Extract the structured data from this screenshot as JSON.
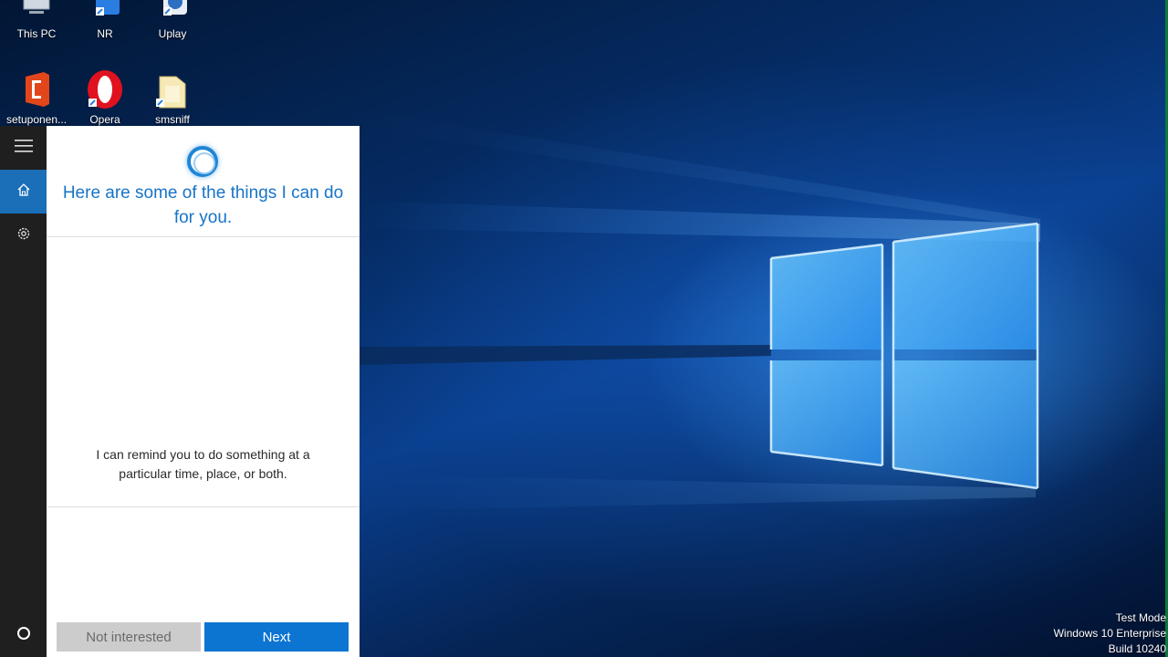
{
  "desktop": {
    "icons": [
      {
        "label": "This PC",
        "icon": "computer-icon"
      },
      {
        "label": "NR",
        "icon": "nr-app-icon"
      },
      {
        "label": "Uplay",
        "icon": "uplay-icon"
      },
      {
        "label": "setuponen...",
        "icon": "office-setup-icon"
      },
      {
        "label": "Opera",
        "icon": "opera-icon"
      },
      {
        "label": "smsniff",
        "icon": "folder-icon"
      }
    ],
    "watermark": {
      "line1": "Test Mode",
      "line2": "Windows 10 Enterprise",
      "line3": "Build 10240"
    }
  },
  "cortana": {
    "rail": [
      {
        "icon": "hamburger-menu-icon"
      },
      {
        "icon": "home-icon",
        "active": true
      },
      {
        "icon": "gear-icon"
      },
      {
        "icon": "cortana-circle-icon"
      }
    ],
    "headline": "Here are some of the things I can do for you.",
    "description": "I can remind you to do something at a particular time, place, or both.",
    "buttons": {
      "secondary": "Not interested",
      "primary": "Next"
    },
    "colors": {
      "accent": "#1774c7",
      "primary_button": "#0c74d1",
      "rail_active": "#1a6fb8"
    }
  }
}
